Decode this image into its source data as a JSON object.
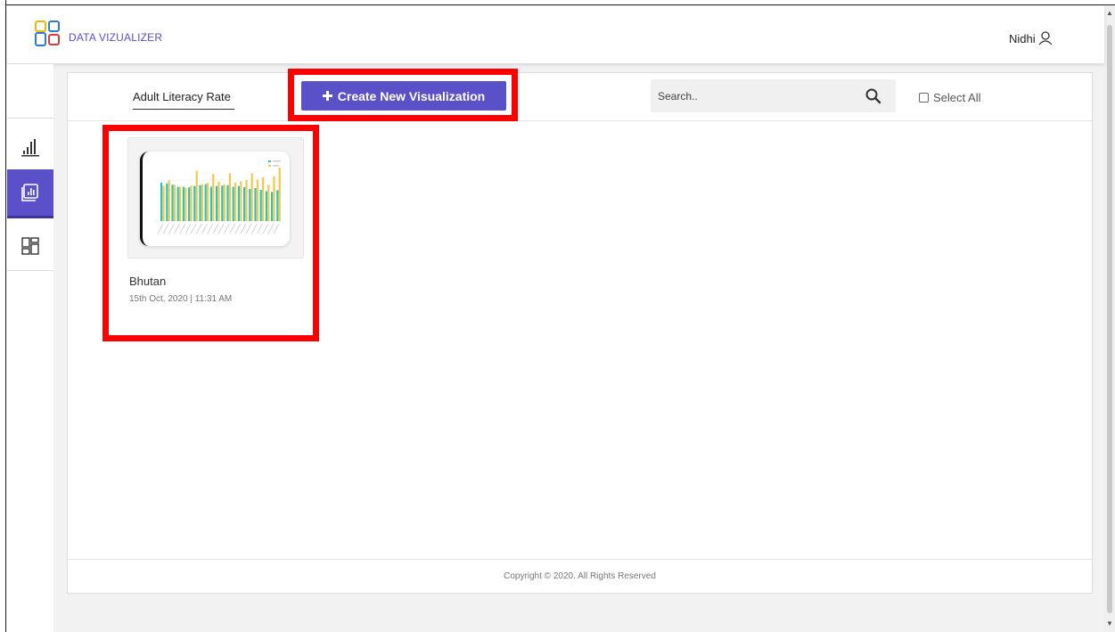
{
  "header": {
    "brand": "DATA VIZUALIZER",
    "user_name": "Nidhi",
    "logo_colors": [
      "#f2b705",
      "#2e7bd6",
      "#3cb371",
      "#e53935"
    ]
  },
  "sidebar": {
    "items": [
      {
        "icon": "bar-chart-icon",
        "active": false
      },
      {
        "icon": "report-chart-icon",
        "active": true
      },
      {
        "icon": "dashboard-grid-icon",
        "active": false
      }
    ]
  },
  "toolbar": {
    "active_tab": "Adult Literacy Rate",
    "create_label": "Create New Visualization",
    "search_placeholder": "Search..",
    "select_all_label": "Select All"
  },
  "cards": [
    {
      "title": "Bhutan",
      "date": "15th Oct, 2020  |  11:31 AM"
    }
  ],
  "footer": {
    "copyright": "Copyright © 2020. All Rights Reserved"
  },
  "colors": {
    "accent": "#5a50c8",
    "highlight": "#ff0000",
    "bar_series_a": "#2fc3b8",
    "bar_series_b": "#f2c94c"
  }
}
